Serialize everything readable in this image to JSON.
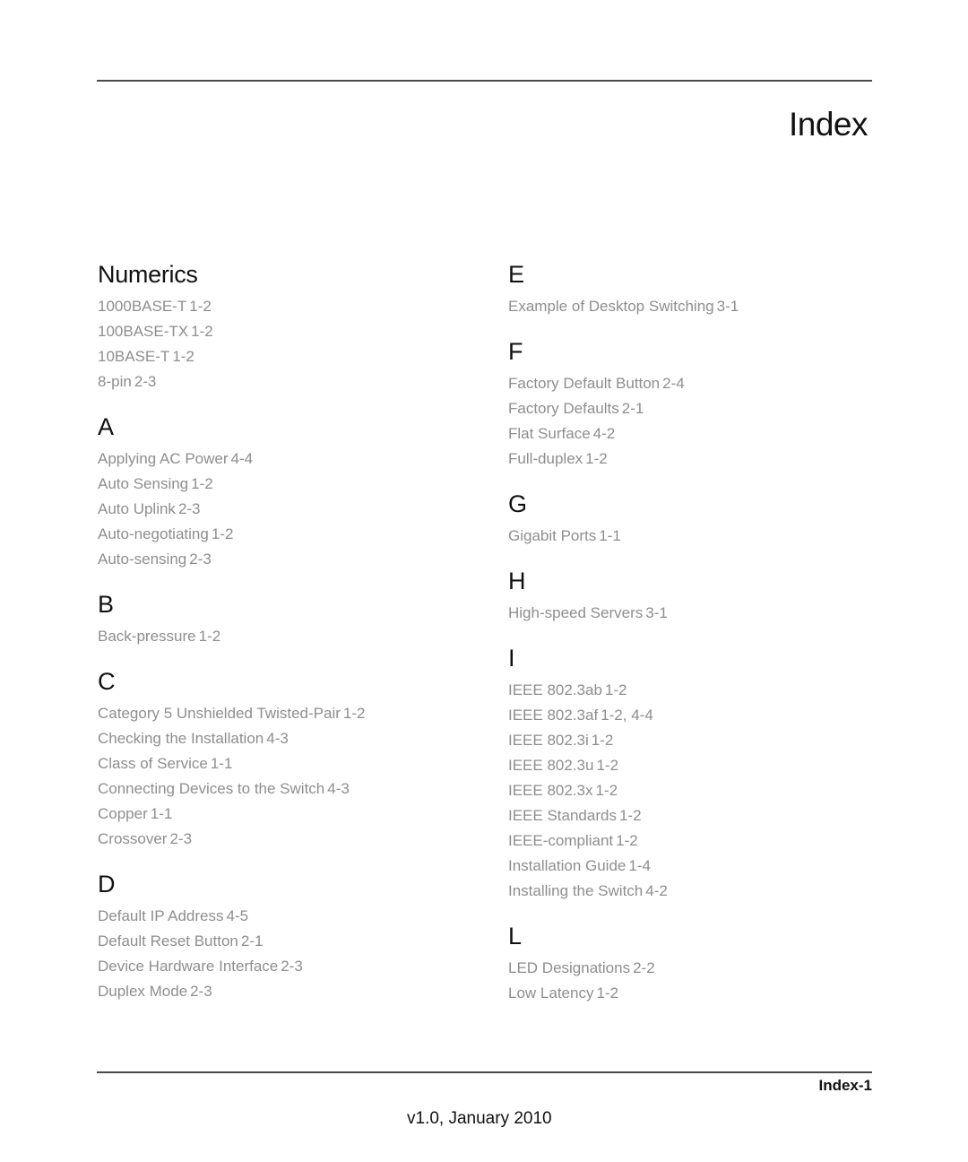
{
  "header": {
    "title": "Index"
  },
  "left_column": [
    {
      "heading": "Numerics",
      "entries": [
        {
          "term": "1000BASE-T",
          "page": "1-2"
        },
        {
          "term": "100BASE-TX",
          "page": "1-2"
        },
        {
          "term": "10BASE-T",
          "page": "1-2"
        },
        {
          "term": "8-pin",
          "page": "2-3"
        }
      ]
    },
    {
      "heading": "A",
      "entries": [
        {
          "term": "Applying AC Power",
          "page": "4-4"
        },
        {
          "term": "Auto Sensing",
          "page": "1-2"
        },
        {
          "term": "Auto Uplink",
          "page": "2-3"
        },
        {
          "term": "Auto-negotiating",
          "page": "1-2"
        },
        {
          "term": "Auto-sensing",
          "page": "2-3"
        }
      ]
    },
    {
      "heading": "B",
      "entries": [
        {
          "term": "Back-pressure",
          "page": "1-2"
        }
      ]
    },
    {
      "heading": "C",
      "entries": [
        {
          "term": "Category 5 Unshielded Twisted-Pair",
          "page": "1-2"
        },
        {
          "term": "Checking the Installation",
          "page": "4-3"
        },
        {
          "term": "Class of Service",
          "page": "1-1"
        },
        {
          "term": "Connecting Devices to the Switch",
          "page": "4-3"
        },
        {
          "term": "Copper",
          "page": "1-1"
        },
        {
          "term": "Crossover",
          "page": "2-3"
        }
      ]
    },
    {
      "heading": "D",
      "entries": [
        {
          "term": "Default IP Address",
          "page": "4-5"
        },
        {
          "term": "Default Reset Button",
          "page": "2-1"
        },
        {
          "term": "Device Hardware Interface",
          "page": "2-3"
        },
        {
          "term": "Duplex Mode",
          "page": "2-3"
        }
      ]
    }
  ],
  "right_column": [
    {
      "heading": "E",
      "entries": [
        {
          "term": "Example of Desktop Switching",
          "page": "3-1"
        }
      ]
    },
    {
      "heading": "F",
      "entries": [
        {
          "term": "Factory Default Button",
          "page": "2-4"
        },
        {
          "term": "Factory Defaults",
          "page": "2-1"
        },
        {
          "term": "Flat Surface",
          "page": "4-2"
        },
        {
          "term": "Full-duplex",
          "page": "1-2"
        }
      ]
    },
    {
      "heading": "G",
      "entries": [
        {
          "term": "Gigabit Ports",
          "page": "1-1"
        }
      ]
    },
    {
      "heading": "H",
      "entries": [
        {
          "term": "High-speed Servers",
          "page": "3-1"
        }
      ]
    },
    {
      "heading": "I",
      "entries": [
        {
          "term": "IEEE 802.3ab",
          "page": "1-2"
        },
        {
          "term": "IEEE 802.3af",
          "page": "1-2, 4-4"
        },
        {
          "term": "IEEE 802.3i",
          "page": "1-2"
        },
        {
          "term": "IEEE 802.3u",
          "page": "1-2"
        },
        {
          "term": "IEEE 802.3x",
          "page": "1-2"
        },
        {
          "term": "IEEE Standards",
          "page": "1-2"
        },
        {
          "term": "IEEE-compliant",
          "page": "1-2"
        },
        {
          "term": "Installation Guide",
          "page": "1-4"
        },
        {
          "term": "Installing the Switch",
          "page": "4-2"
        }
      ]
    },
    {
      "heading": "L",
      "entries": [
        {
          "term": "LED Designations",
          "page": "2-2"
        },
        {
          "term": "Low Latency",
          "page": "1-2"
        }
      ]
    }
  ],
  "footer": {
    "page_label": "Index-1",
    "version": "v1.0, January 2010"
  }
}
